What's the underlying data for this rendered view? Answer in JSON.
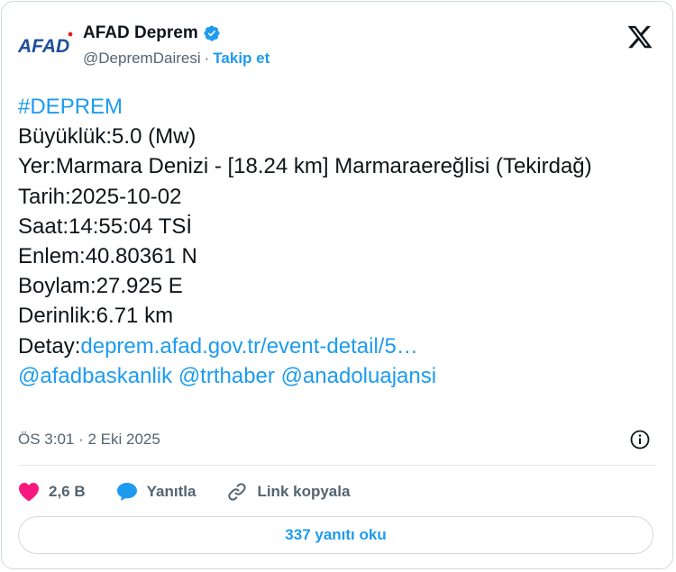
{
  "account": {
    "avatar_text": "AFAD",
    "name": "AFAD Deprem",
    "handle": "@DepremDairesi",
    "separator": "·",
    "follow_label": "Takip et"
  },
  "tweet": {
    "hashtag": "#DEPREM",
    "magnitude": "Büyüklük:5.0 (Mw)",
    "location": "Yer:Marmara Denizi - [18.24 km] Marmaraereğlisi (Tekirdağ)",
    "date": "Tarih:2025-10-02",
    "time": "Saat:14:55:04 TSİ",
    "latitude": "Enlem:40.80361 N",
    "longitude": "Boylam:27.925 E",
    "depth": "Derinlik:6.71 km",
    "detail_prefix": "Detay:",
    "detail_link": "deprem.afad.gov.tr/event-detail/5…",
    "mention_1": "@afadbaskanlik",
    "mention_2": "@trthaber",
    "mention_3": "@anadoluajansi",
    "timestamp": "ÖS 3:01 · 2 Eki 2025"
  },
  "actions": {
    "like_count": "2,6 B",
    "reply_label": "Yanıtla",
    "copy_link_label": "Link kopyala"
  },
  "footer": {
    "read_replies_label": "337 yanıtı oku"
  },
  "colors": {
    "accent": "#1d9bf0",
    "like": "#f91880",
    "text": "#0f1419",
    "muted": "#536471",
    "afad_blue": "#1f4e9c",
    "afad_red": "#e2231a"
  }
}
